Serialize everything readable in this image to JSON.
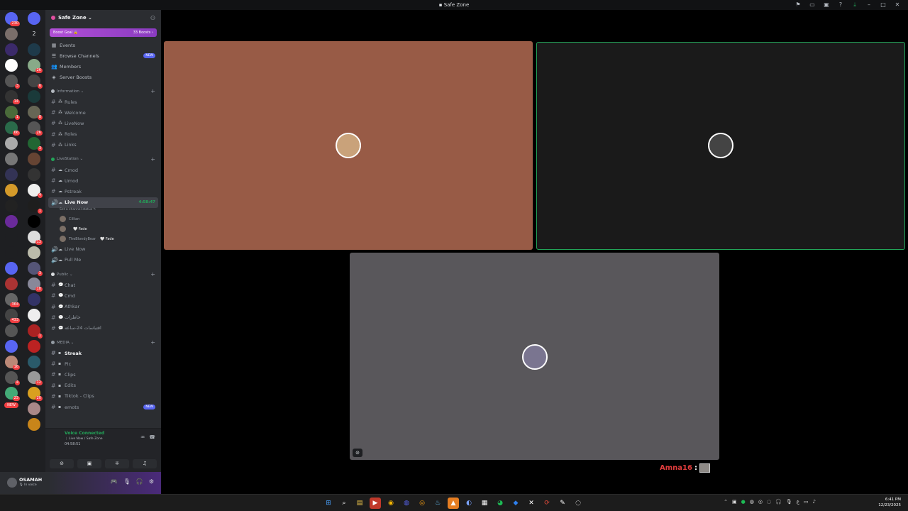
{
  "window": {
    "title": "Safe Zone"
  },
  "servers_col1": [
    {
      "icon": "discord-home-icon",
      "color": "#5865f2",
      "badge": "230"
    },
    {
      "icon": "server-avatar-icon",
      "color": "#7a6e6a",
      "badge": ""
    },
    {
      "icon": "server-logo-icon",
      "color": "#3b2a6a",
      "badge": ""
    },
    {
      "icon": "server-logo-icon",
      "color": "#ffffff",
      "badge": ""
    },
    {
      "icon": "server-avatar-icon",
      "color": "#555",
      "badge": "3"
    },
    {
      "icon": "server-avatar-icon",
      "color": "#333",
      "badge": "14"
    },
    {
      "icon": "server-avatar-icon",
      "color": "#4a6a3a",
      "badge": "1"
    },
    {
      "icon": "server-avatar-icon",
      "color": "#2a6a4a",
      "badge": "66"
    },
    {
      "icon": "server-avatar-icon",
      "color": "#aaa",
      "badge": ""
    },
    {
      "icon": "server-avatar-icon",
      "color": "#777",
      "badge": ""
    },
    {
      "icon": "server-avatar-icon",
      "color": "#335",
      "badge": ""
    },
    {
      "icon": "server-avatar-icon",
      "color": "#d49a2a",
      "badge": ""
    },
    {
      "icon": "server-logo-icon",
      "color": "#222",
      "badge": ""
    },
    {
      "icon": "server-logo-icon",
      "color": "#6a2a9a",
      "badge": ""
    },
    {
      "icon": "server-logo-icon",
      "color": "#1e1f22",
      "badge": ""
    },
    {
      "icon": "server-text-icon",
      "color": "#1e1f22",
      "badge": ""
    },
    {
      "icon": "server-folder-icon",
      "color": "#5865f2",
      "badge": ""
    },
    {
      "icon": "server-avatar-icon",
      "color": "#a33",
      "badge": ""
    },
    {
      "icon": "server-avatar-icon",
      "color": "#666",
      "badge": "364"
    },
    {
      "icon": "server-avatar-icon",
      "color": "#444",
      "badge": "433"
    },
    {
      "icon": "server-avatar-icon",
      "color": "#555",
      "badge": ""
    },
    {
      "icon": "server-avatar-icon",
      "color": "#5865f2",
      "badge": ""
    },
    {
      "icon": "server-avatar-icon",
      "color": "#b87",
      "badge": "16"
    },
    {
      "icon": "server-avatar-icon",
      "color": "#555",
      "badge": "4"
    },
    {
      "icon": "server-avatar-icon",
      "color": "#4a7",
      "badge": "23"
    }
  ],
  "servers_col2": [
    {
      "icon": "server-folder-icon",
      "color": "#5865f2",
      "badge": ""
    },
    {
      "icon": "server-count-icon",
      "color": "#1e1f22",
      "badge": ""
    },
    {
      "icon": "server-logo-icon",
      "color": "#1e3a4a",
      "badge": ""
    },
    {
      "icon": "server-avatar-icon",
      "color": "#8a8",
      "badge": "26"
    },
    {
      "icon": "server-avatar-icon",
      "color": "#444",
      "badge": "6"
    },
    {
      "icon": "server-avatar-icon",
      "color": "#1a3a3a",
      "badge": ""
    },
    {
      "icon": "server-avatar-icon",
      "color": "#665",
      "badge": "8"
    },
    {
      "icon": "server-avatar-icon",
      "color": "#555",
      "badge": "26"
    },
    {
      "icon": "server-avatar-icon",
      "color": "#263",
      "badge": "3"
    },
    {
      "icon": "server-avatar-icon",
      "color": "#643",
      "badge": ""
    },
    {
      "icon": "server-avatar-icon",
      "color": "#333",
      "badge": ""
    },
    {
      "icon": "server-avatar-icon",
      "color": "#eee",
      "badge": "4"
    },
    {
      "icon": "server-avatar-icon",
      "color": "#1e1e1e",
      "badge": "1"
    },
    {
      "icon": "server-avatar-icon",
      "color": "#000",
      "badge": ""
    },
    {
      "icon": "server-avatar-icon",
      "color": "#ddd",
      "badge": "13"
    },
    {
      "icon": "server-avatar-icon",
      "color": "#bba",
      "badge": ""
    },
    {
      "icon": "server-avatar-icon",
      "color": "#557",
      "badge": "3"
    },
    {
      "icon": "server-avatar-icon",
      "color": "#889",
      "badge": "18"
    },
    {
      "icon": "server-avatar-icon",
      "color": "#336",
      "badge": ""
    },
    {
      "icon": "server-avatar-icon",
      "color": "#eee",
      "badge": ""
    },
    {
      "icon": "server-avatar-icon",
      "color": "#a22",
      "badge": "1"
    },
    {
      "icon": "server-avatar-icon",
      "color": "#b22",
      "badge": ""
    },
    {
      "icon": "server-avatar-icon",
      "color": "#2a5a6a",
      "badge": ""
    },
    {
      "icon": "server-avatar-icon",
      "color": "#999",
      "badge": "12"
    },
    {
      "icon": "server-avatar-icon",
      "color": "#d9a020",
      "badge": "20"
    },
    {
      "icon": "server-avatar-icon",
      "color": "#a88",
      "badge": ""
    },
    {
      "icon": "server-avatar-icon",
      "color": "#c8851a",
      "badge": ""
    }
  ],
  "servers_col1_extra": {
    "count": "2",
    "new_label": "NEW"
  },
  "server": {
    "name": "Safe Zone ⌄",
    "boost_goal": "Boost Goal 🔒",
    "boosts": "33 Boosts ›"
  },
  "menu": [
    {
      "icon": "calendar-icon",
      "glyph": "▦",
      "label": "Events",
      "new": ""
    },
    {
      "icon": "browse-channels-icon",
      "glyph": "☰",
      "label": "Browse Channels",
      "new": "NEW"
    },
    {
      "icon": "members-icon",
      "glyph": "👥",
      "label": "Members",
      "new": ""
    },
    {
      "icon": "server-boost-icon",
      "glyph": "◈",
      "label": "Server Boosts",
      "new": ""
    }
  ],
  "categories": {
    "information": "Information ⌄",
    "livestation": "LiveStation ⌄",
    "public": "Public ⌄",
    "media": "MEDIA ⌄"
  },
  "info_channels": [
    "Rules",
    "Welcome",
    "LiveNow",
    "Roles",
    "Links"
  ],
  "livestation_channels": [
    "Cmod",
    "Umod",
    "Pstreak"
  ],
  "active_voice": {
    "name": "Live Now",
    "time": "4:58:47",
    "status": "Set a channel status ✎",
    "users": [
      {
        "name": "Cillian",
        "tag": ""
      },
      {
        "name": "",
        "tag": "🤍 Fade"
      },
      {
        "name": "TheBlondyBear",
        "tag": "🤍 Fade"
      }
    ]
  },
  "voice_channels": [
    "Live Now",
    "Pull Me"
  ],
  "public_channels": [
    "Chat",
    "Cmd",
    "Athkar",
    "خاطرات",
    "اقتباسات 24-ساعه"
  ],
  "media_channels": [
    {
      "label": "Streak",
      "bold": true,
      "new": ""
    },
    {
      "label": "Pic",
      "bold": false,
      "new": ""
    },
    {
      "label": "Clips",
      "bold": false,
      "new": ""
    },
    {
      "label": "Edits",
      "bold": false,
      "new": ""
    },
    {
      "label": "Tiktok - Clips",
      "bold": false,
      "new": ""
    },
    {
      "label": "emots",
      "bold": false,
      "new": "NEW"
    }
  ],
  "voice_panel": {
    "title": "Voice Connected",
    "location": "⋮ Live Now / Safe Zone",
    "elapsed": "04:58:51"
  },
  "user": {
    "name": "OSAMAH",
    "status": "🎙 In voice"
  },
  "stage": {
    "tiles": [
      {
        "bg": "#985b46"
      },
      {
        "bg": "#1a1a1a",
        "speaking_color": "#23a559"
      },
      {
        "bg": "#59575b"
      }
    ],
    "overlay_name": "Amna16",
    "overlay_sep": ":"
  },
  "clock": {
    "time": "6:41 PM",
    "date": "12/23/2025"
  }
}
